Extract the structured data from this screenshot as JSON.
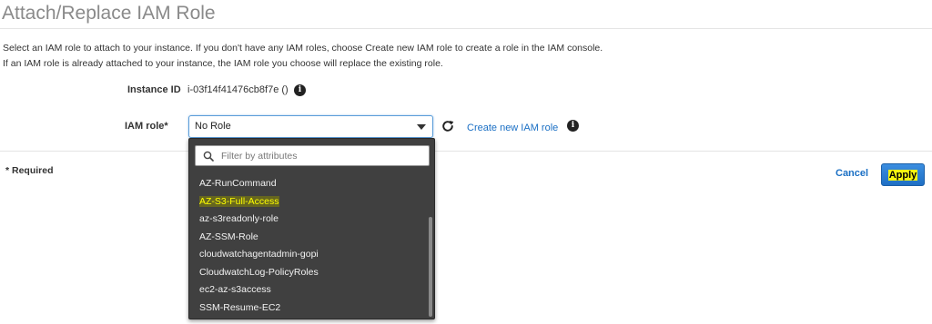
{
  "page": {
    "title": "Attach/Replace IAM Role",
    "description_line1": "Select an IAM role to attach to your instance. If you don't have any IAM roles, choose Create new IAM role to create a role in the IAM console.",
    "description_line2": "If an IAM role is already attached to your instance, the IAM role you choose will replace the existing role."
  },
  "form": {
    "instance_id_label": "Instance ID",
    "instance_id_value": "i-03f14f41476cb8f7e ()",
    "iam_role_label": "IAM role*",
    "iam_role_value": "No Role",
    "create_link": "Create new IAM role",
    "required_note": "* Required"
  },
  "dropdown": {
    "filter_placeholder": "Filter by attributes",
    "options": [
      "AZ-RunCommand",
      "AZ-S3-Full-Access",
      "az-s3readonly-role",
      "AZ-SSM-Role",
      "cloudwatchagentadmin-gopi",
      "CloudwatchLog-PolicyRoles",
      "ec2-az-s3access",
      "SSM-Resume-EC2"
    ],
    "highlighted_option": "AZ-S3-Full-Access"
  },
  "actions": {
    "cancel_label": "Cancel",
    "apply_label": "Apply"
  },
  "icons": {
    "info": "info-icon",
    "refresh": "refresh-icon",
    "search": "search-icon",
    "caret": "chevron-down-icon"
  },
  "colors": {
    "link": "#1a6fc4",
    "primary_button": "#1f6fc4",
    "dropdown_bg": "#404040",
    "highlight": "#ffff00"
  }
}
